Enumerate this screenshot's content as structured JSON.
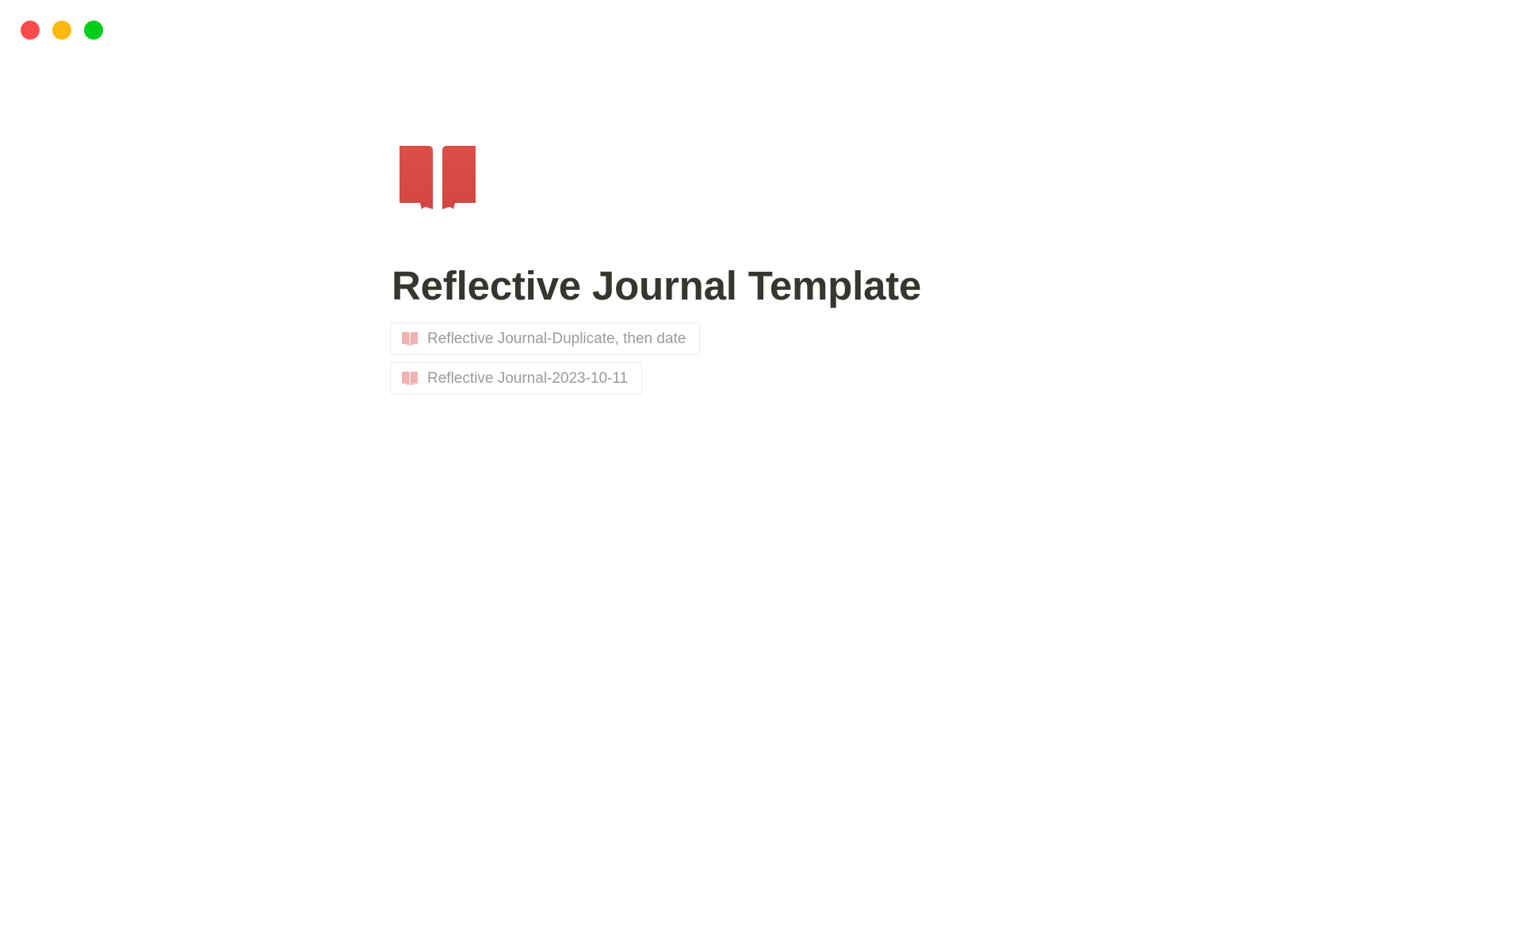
{
  "window": {
    "controls": [
      {
        "name": "close",
        "color": "#ff4a4a"
      },
      {
        "name": "minimize",
        "color": "#ffb80f"
      },
      {
        "name": "maximize",
        "color": "#00cd1c"
      }
    ]
  },
  "page": {
    "icon": "open-book-icon",
    "icon_color": "#d9534f",
    "title": "Reflective Journal Template",
    "subpages": [
      {
        "label": "Reflective Journal-Duplicate, then date",
        "icon": "open-book-icon"
      },
      {
        "label": "Reflective Journal-2023-10-11",
        "icon": "open-book-icon"
      }
    ]
  }
}
